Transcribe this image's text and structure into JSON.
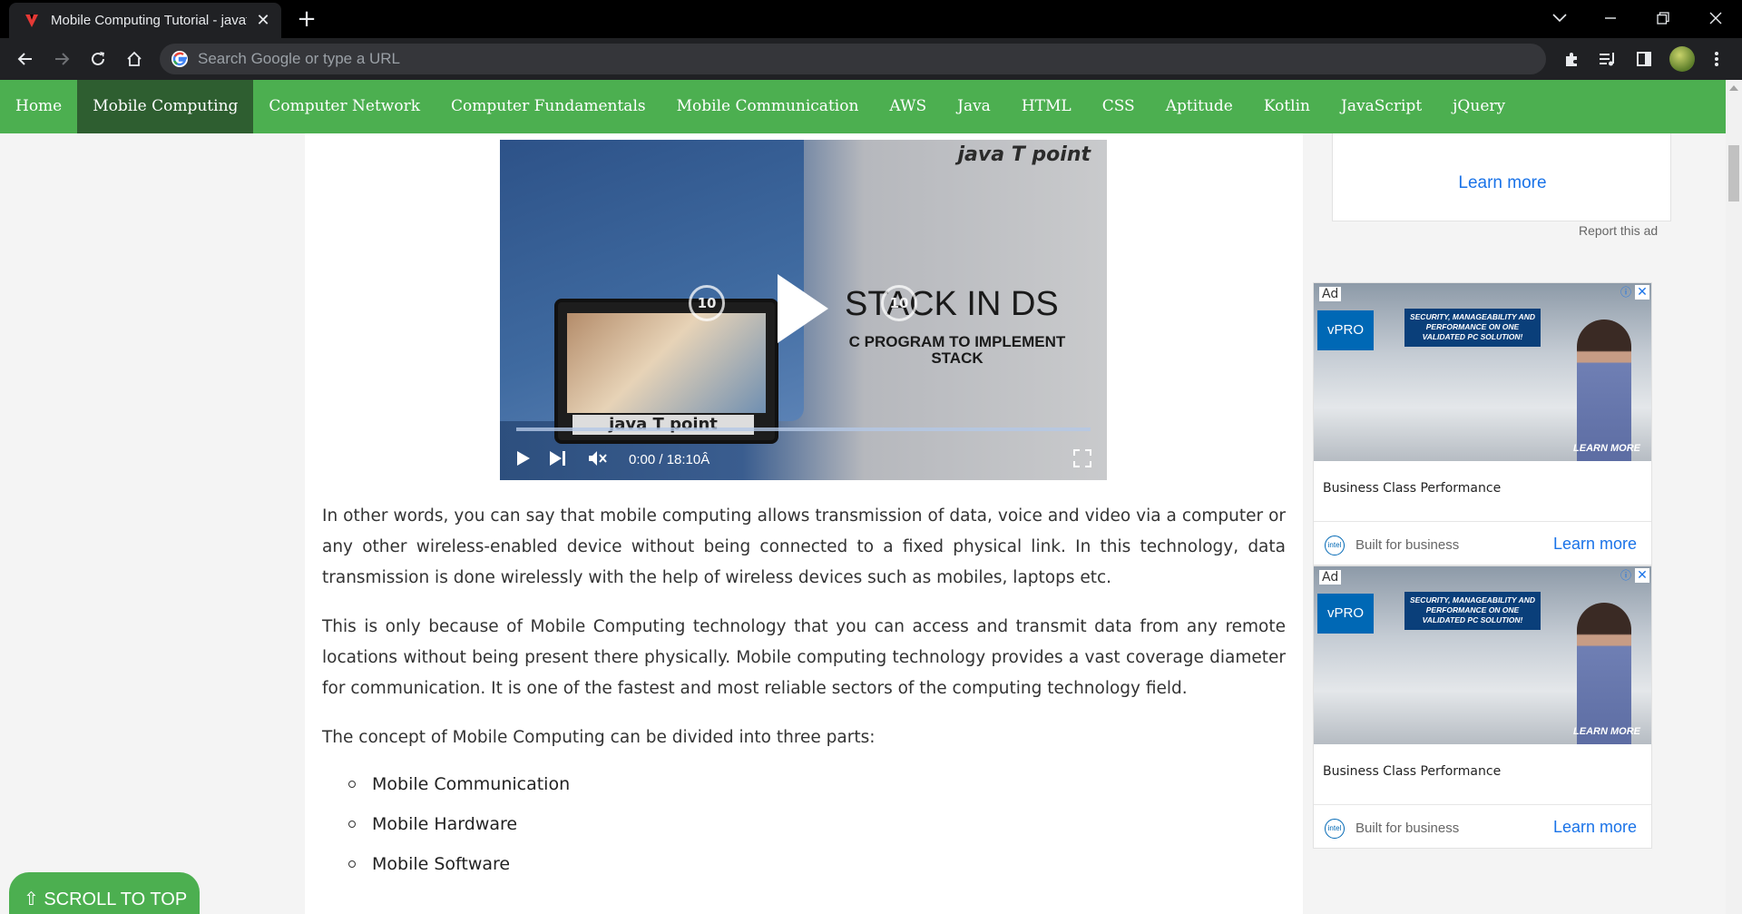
{
  "browser": {
    "tab_title": "Mobile Computing Tutorial - javatpoint",
    "tab_close": "✕",
    "new_tab": "+",
    "omnibox_placeholder": "Search Google or type a URL"
  },
  "nav": {
    "items": [
      {
        "label": "Home",
        "active": false
      },
      {
        "label": "Mobile Computing",
        "active": true
      },
      {
        "label": "Computer Network",
        "active": false
      },
      {
        "label": "Computer Fundamentals",
        "active": false
      },
      {
        "label": "Mobile Communication",
        "active": false
      },
      {
        "label": "AWS",
        "active": false
      },
      {
        "label": "Java",
        "active": false
      },
      {
        "label": "HTML",
        "active": false
      },
      {
        "label": "CSS",
        "active": false
      },
      {
        "label": "Aptitude",
        "active": false
      },
      {
        "label": "Kotlin",
        "active": false
      },
      {
        "label": "JavaScript",
        "active": false
      },
      {
        "label": "jQuery",
        "active": false
      }
    ],
    "color": "#4caf50",
    "active_color": "#2e5e30"
  },
  "video": {
    "brand": "java T point",
    "headline": "STACK IN DS",
    "subline": "C PROGRAM TO IMPLEMENT STACK",
    "laptop_brand": "java T point",
    "skip_back": "10",
    "skip_forward": "10",
    "time": "0:00 / 18:10Â",
    "muted": true
  },
  "article": {
    "paragraphs": [
      "In other words, you can say that mobile computing allows transmission of data, voice and video via a computer or any other wireless-enabled device without being connected to a fixed physical link. In this technology, data transmission is done wirelessly with the help of wireless devices such as mobiles, laptops etc.",
      "This is only because of Mobile Computing technology that you can access and transmit data from any remote locations without being present there physically. Mobile computing technology provides a vast coverage diameter for communication. It is one of the fastest and most reliable sectors of the computing technology field.",
      "The concept of Mobile Computing can be divided into three parts:"
    ],
    "list": [
      "Mobile Communication",
      "Mobile Hardware",
      "Mobile Software"
    ]
  },
  "sidebar": {
    "top_ad_learn_more": "Learn more",
    "report_ad": "Report this ad",
    "ads": [
      {
        "label": "Ad",
        "brand": "vPRO",
        "banner": "SECURITY, MANAGEABILITY AND PERFORMANCE ON ONE VALIDATED PC SOLUTION!",
        "image_cta": "LEARN MORE",
        "headline": "Business Class Performance",
        "advertiser": "Built for business",
        "cta": "Learn more",
        "logo": "intel"
      },
      {
        "label": "Ad",
        "brand": "vPRO",
        "banner": "SECURITY, MANAGEABILITY AND PERFORMANCE ON ONE VALIDATED PC SOLUTION!",
        "image_cta": "LEARN MORE",
        "headline": "Business Class Performance",
        "advertiser": "Built for business",
        "cta": "Learn more",
        "logo": "intel"
      }
    ]
  },
  "scroll_to_top": "⇧ SCROLL TO TOP"
}
